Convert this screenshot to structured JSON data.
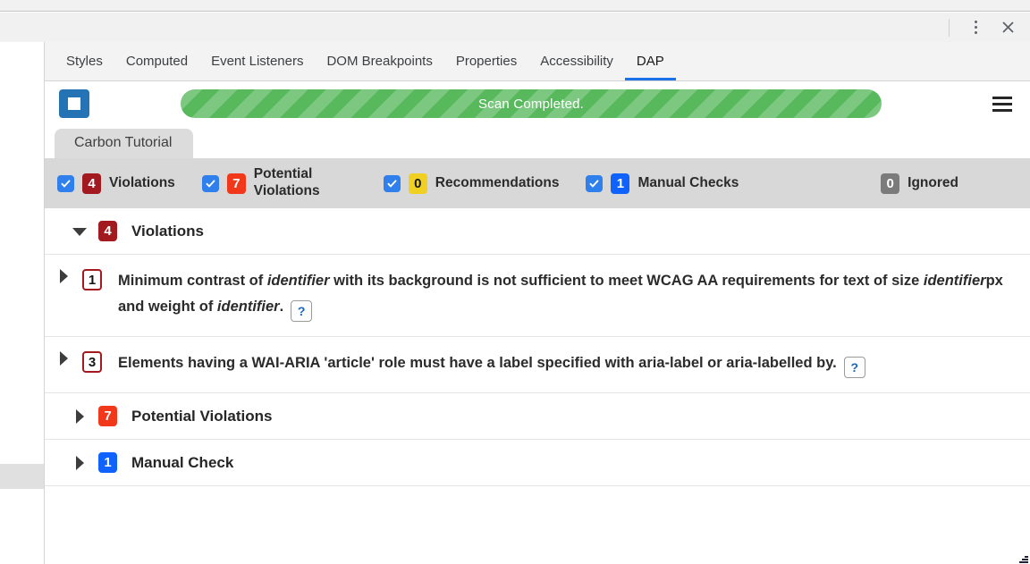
{
  "window": {
    "menu_icon": "dots-vertical-icon",
    "close_icon": "close-icon"
  },
  "devtools_tabs": [
    {
      "label": "Styles",
      "active": false
    },
    {
      "label": "Computed",
      "active": false
    },
    {
      "label": "Event Listeners",
      "active": false
    },
    {
      "label": "DOM Breakpoints",
      "active": false
    },
    {
      "label": "Properties",
      "active": false
    },
    {
      "label": "Accessibility",
      "active": false
    },
    {
      "label": "DAP",
      "active": true
    }
  ],
  "scanbar": {
    "stop_button_name": "stop-scan-button",
    "progress_text": "Scan Completed.",
    "progress_color": "#57b85c",
    "menu_icon": "hamburger-menu-icon"
  },
  "report_tab": {
    "label": "Carbon Tutorial"
  },
  "summary": {
    "filters": [
      {
        "count": "4",
        "label": "Violations",
        "color": "#a2191f",
        "checked": true,
        "has_checkbox": true
      },
      {
        "count": "7",
        "label": "Potential Violations",
        "color": "#f1381a",
        "checked": true,
        "has_checkbox": true
      },
      {
        "count": "0",
        "label": "Recommendations",
        "color": "#f1d024",
        "checked": true,
        "has_checkbox": true
      },
      {
        "count": "1",
        "label": "Manual Checks",
        "color": "#0f62fe",
        "checked": true,
        "has_checkbox": true
      },
      {
        "count": "0",
        "label": "Ignored",
        "color": "#7b7b7b",
        "checked": false,
        "has_checkbox": false
      }
    ]
  },
  "tree": {
    "groups": [
      {
        "count": "4",
        "label": "Violations",
        "color": "#a2191f",
        "expanded": true,
        "items": [
          {
            "count": "1",
            "text_parts": [
              {
                "t": "Minimum contrast of ",
                "i": false
              },
              {
                "t": "identifier",
                "i": true
              },
              {
                "t": " with its background is not sufficient to meet WCAG AA requirements for text of size ",
                "i": false
              },
              {
                "t": "identifier",
                "i": true
              },
              {
                "t": "px and weight of ",
                "i": false
              },
              {
                "t": "identifier",
                "i": true
              },
              {
                "t": ".",
                "i": false
              }
            ],
            "help_label": "?"
          },
          {
            "count": "3",
            "text_parts": [
              {
                "t": "Elements having a WAI-ARIA 'article' role must have a label specified with aria-label or aria-labelled by.",
                "i": false
              }
            ],
            "help_label": "?"
          }
        ]
      },
      {
        "count": "7",
        "label": "Potential Violations",
        "color": "#f1381a",
        "expanded": false,
        "items": []
      },
      {
        "count": "1",
        "label": "Manual Check",
        "color": "#0f62fe",
        "expanded": false,
        "items": []
      }
    ]
  }
}
